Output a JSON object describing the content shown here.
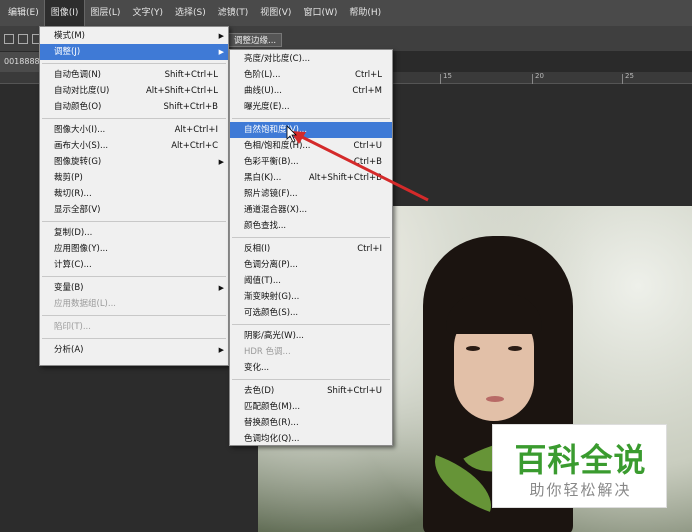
{
  "menubar": {
    "items": [
      "编辑(E)",
      "图像(I)",
      "图层(L)",
      "文字(Y)",
      "选择(S)",
      "滤镜(T)",
      "视图(V)",
      "窗口(W)",
      "帮助(H)"
    ],
    "active_index": 1
  },
  "optbar": {
    "refine_edge": "调整边缘..."
  },
  "tab": {
    "label": "0018888..."
  },
  "ruler": {
    "ticks": [
      "15",
      "20",
      "25"
    ]
  },
  "image_menu": {
    "items": [
      {
        "label": "模式(M)",
        "shortcut": "",
        "submenu": true,
        "disabled": false
      },
      {
        "label": "调整(J)",
        "shortcut": "",
        "submenu": true,
        "disabled": false,
        "highlight": true
      },
      {
        "label": "自动色调(N)",
        "shortcut": "Shift+Ctrl+L",
        "disabled": false
      },
      {
        "label": "自动对比度(U)",
        "shortcut": "Alt+Shift+Ctrl+L",
        "disabled": false
      },
      {
        "label": "自动颜色(O)",
        "shortcut": "Shift+Ctrl+B",
        "disabled": false
      },
      {
        "label": "图像大小(I)...",
        "shortcut": "Alt+Ctrl+I",
        "disabled": false
      },
      {
        "label": "画布大小(S)...",
        "shortcut": "Alt+Ctrl+C",
        "disabled": false
      },
      {
        "label": "图像旋转(G)",
        "shortcut": "",
        "submenu": true,
        "disabled": false
      },
      {
        "label": "裁剪(P)",
        "shortcut": "",
        "disabled": false
      },
      {
        "label": "裁切(R)...",
        "shortcut": "",
        "disabled": false
      },
      {
        "label": "显示全部(V)",
        "shortcut": "",
        "disabled": false
      },
      {
        "label": "复制(D)...",
        "shortcut": "",
        "disabled": false
      },
      {
        "label": "应用图像(Y)...",
        "shortcut": "",
        "disabled": false
      },
      {
        "label": "计算(C)...",
        "shortcut": "",
        "disabled": false
      },
      {
        "label": "变量(B)",
        "shortcut": "",
        "submenu": true,
        "disabled": false
      },
      {
        "label": "应用数据组(L)...",
        "shortcut": "",
        "disabled": true
      },
      {
        "label": "陷印(T)...",
        "shortcut": "",
        "disabled": true
      },
      {
        "label": "分析(A)",
        "shortcut": "",
        "submenu": true,
        "disabled": false
      }
    ]
  },
  "adjust_menu": {
    "items": [
      {
        "label": "亮度/对比度(C)...",
        "shortcut": ""
      },
      {
        "label": "色阶(L)...",
        "shortcut": "Ctrl+L"
      },
      {
        "label": "曲线(U)...",
        "shortcut": "Ctrl+M"
      },
      {
        "label": "曝光度(E)...",
        "shortcut": ""
      },
      {
        "label": "自然饱和度(V)...",
        "shortcut": "",
        "highlight": true
      },
      {
        "label": "色相/饱和度(H)...",
        "shortcut": "Ctrl+U"
      },
      {
        "label": "色彩平衡(B)...",
        "shortcut": "Ctrl+B"
      },
      {
        "label": "黑白(K)...",
        "shortcut": "Alt+Shift+Ctrl+B"
      },
      {
        "label": "照片滤镜(F)...",
        "shortcut": ""
      },
      {
        "label": "通道混合器(X)...",
        "shortcut": ""
      },
      {
        "label": "颜色查找...",
        "shortcut": ""
      },
      {
        "label": "反相(I)",
        "shortcut": "Ctrl+I"
      },
      {
        "label": "色调分离(P)...",
        "shortcut": ""
      },
      {
        "label": "阈值(T)...",
        "shortcut": ""
      },
      {
        "label": "渐变映射(G)...",
        "shortcut": ""
      },
      {
        "label": "可选颜色(S)...",
        "shortcut": ""
      },
      {
        "label": "阴影/高光(W)...",
        "shortcut": ""
      },
      {
        "label": "HDR 色调...",
        "shortcut": "",
        "disabled": true
      },
      {
        "label": "变化...",
        "shortcut": ""
      },
      {
        "label": "去色(D)",
        "shortcut": "Shift+Ctrl+U"
      },
      {
        "label": "匹配颜色(M)...",
        "shortcut": ""
      },
      {
        "label": "替换颜色(R)...",
        "shortcut": ""
      },
      {
        "label": "色调均化(Q)...",
        "shortcut": ""
      }
    ]
  },
  "watermark": {
    "title": "百科全说",
    "subtitle": "助你轻松解决"
  },
  "colors": {
    "highlight": "#3f7ad6",
    "arrow": "#d42a2a",
    "watermark_green": "#3a9b2f"
  }
}
